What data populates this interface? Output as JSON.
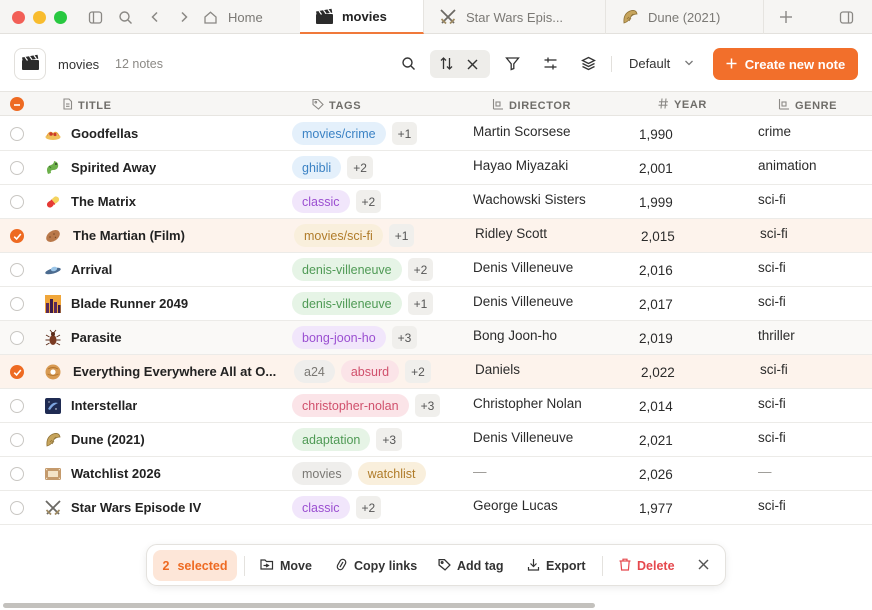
{
  "tabs": [
    {
      "label": "Home"
    },
    {
      "label": "movies",
      "active": true
    },
    {
      "label": "Star Wars Epis..."
    },
    {
      "label": "Dune (2021)"
    }
  ],
  "toolbar": {
    "collection_name": "movies",
    "note_count": "12 notes",
    "view": "Default",
    "create_label": "Create new note"
  },
  "columns": {
    "title": "TITLE",
    "tags": "TAGS",
    "director": "DIRECTOR",
    "year": "YEAR",
    "genre": "GENRE"
  },
  "rows": [
    {
      "title": "Goodfellas",
      "icon": "spaghetti-icon",
      "tags": [
        "movies/crime"
      ],
      "more": "+1",
      "director": "Martin Scorsese",
      "year": "1,990",
      "genre": "crime",
      "selected": false
    },
    {
      "title": "Spirited Away",
      "icon": "dragon-icon",
      "tags": [
        "ghibli"
      ],
      "more": "+2",
      "director": "Hayao Miyazaki",
      "year": "2,001",
      "genre": "animation",
      "selected": false
    },
    {
      "title": "The Matrix",
      "icon": "pill-icon",
      "tags": [
        "classic"
      ],
      "more": "+2",
      "director": "Wachowski Sisters",
      "year": "1,999",
      "genre": "sci-fi",
      "selected": false
    },
    {
      "title": "The Martian (Film)",
      "icon": "potato-icon",
      "tags": [
        "movies/sci-fi"
      ],
      "more": "+1",
      "director": "Ridley Scott",
      "year": "2,015",
      "genre": "sci-fi",
      "selected": true
    },
    {
      "title": "Arrival",
      "icon": "flying-saucer-icon",
      "tags": [
        "denis-villeneuve"
      ],
      "more": "+2",
      "director": "Denis Villeneuve",
      "year": "2,016",
      "genre": "sci-fi",
      "selected": false
    },
    {
      "title": "Blade Runner 2049",
      "icon": "city-icon",
      "tags": [
        "denis-villeneuve"
      ],
      "more": "+1",
      "director": "Denis Villeneuve",
      "year": "2,017",
      "genre": "sci-fi",
      "selected": false
    },
    {
      "title": "Parasite",
      "icon": "bug-icon",
      "tags": [
        "bong-joon-ho"
      ],
      "more": "+3",
      "director": "Bong Joon-ho",
      "year": "2,019",
      "genre": "thriller",
      "selected": false,
      "hover": true
    },
    {
      "title": "Everything Everywhere All at O...",
      "icon": "bagel-icon",
      "tags": [
        "a24",
        "absurd"
      ],
      "more": "+2",
      "director": "Daniels",
      "year": "2,022",
      "genre": "sci-fi",
      "selected": true
    },
    {
      "title": "Interstellar",
      "icon": "galaxy-icon",
      "tags": [
        "christopher-nolan"
      ],
      "more": "+3",
      "director": "Christopher Nolan",
      "year": "2,014",
      "genre": "sci-fi",
      "selected": false
    },
    {
      "title": "Dune (2021)",
      "icon": "sandworm-icon",
      "tags": [
        "adaptation"
      ],
      "more": "+3",
      "director": "Denis Villeneuve",
      "year": "2,021",
      "genre": "sci-fi",
      "selected": false
    },
    {
      "title": "Watchlist 2026",
      "icon": "film-strip-icon",
      "tags": [
        "movies",
        "watchlist"
      ],
      "more": "",
      "director": "—",
      "year": "2,026",
      "genre": "—",
      "selected": false
    },
    {
      "title": "Star Wars Episode IV",
      "icon": "crossed-swords-icon",
      "tags": [
        "classic"
      ],
      "more": "+2",
      "director": "George Lucas",
      "year": "1,977",
      "genre": "sci-fi",
      "selected": false
    }
  ],
  "tag_colors": {
    "movies/crime": {
      "bg": "#e4f0fb",
      "fg": "#3b82c4"
    },
    "ghibli": {
      "bg": "#e4f0fb",
      "fg": "#3b82c4"
    },
    "classic": {
      "bg": "#f1e6fb",
      "fg": "#9b4fd1"
    },
    "movies/sci-fi": {
      "bg": "#f9efdc",
      "fg": "#b07c2a"
    },
    "denis-villeneuve": {
      "bg": "#e6f4e6",
      "fg": "#4f9a55"
    },
    "bong-joon-ho": {
      "bg": "#f1e6fb",
      "fg": "#9b4fd1"
    },
    "a24": {
      "bg": "#efeeec",
      "fg": "#7a7874"
    },
    "absurd": {
      "bg": "#fbe4e8",
      "fg": "#d0506c"
    },
    "christopher-nolan": {
      "bg": "#fbe4e8",
      "fg": "#d0506c"
    },
    "adaptation": {
      "bg": "#e6f4e6",
      "fg": "#4f9a55"
    },
    "movies": {
      "bg": "#efeeec",
      "fg": "#7a7874"
    },
    "watchlist": {
      "bg": "#f9efdc",
      "fg": "#b07c2a"
    }
  },
  "action_bar": {
    "selected_count": "2",
    "selected_label": "selected",
    "move": "Move",
    "copy_links": "Copy links",
    "add_tag": "Add tag",
    "export": "Export",
    "delete": "Delete"
  },
  "colors": {
    "accent": "#f26f2b",
    "selected_row": "#fdf3ec"
  }
}
